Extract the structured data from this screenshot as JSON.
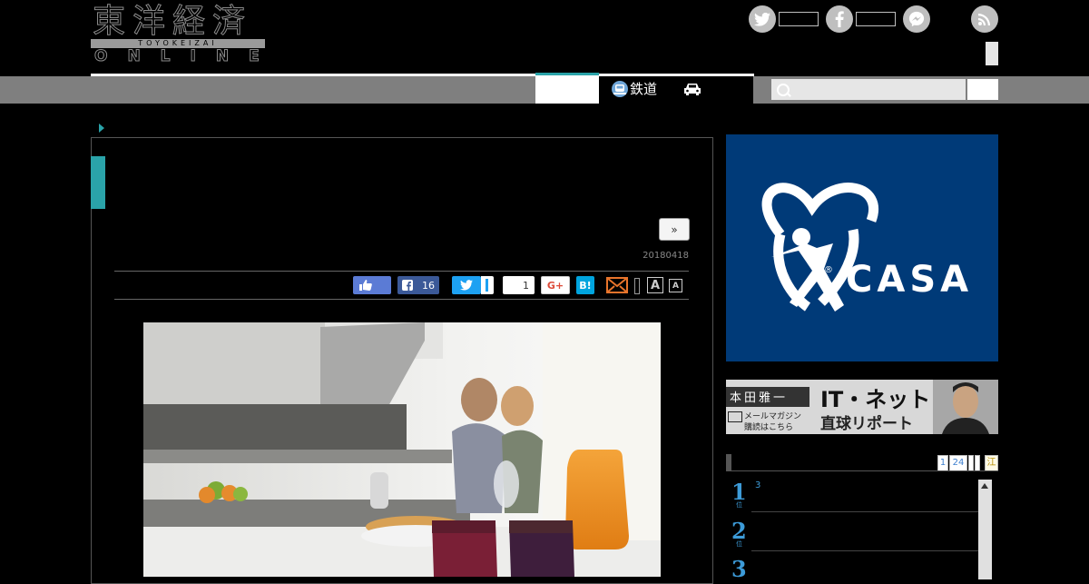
{
  "header": {
    "logo_kanji": "東洋経済",
    "logo_romaji": "TOYOKEIZAI",
    "logo_online": "ONLINE"
  },
  "social": {
    "icons": [
      "twitter-icon",
      "facebook-icon",
      "messenger-icon",
      "rss-icon"
    ]
  },
  "nav": {
    "rail_label": "鉄道",
    "search_placeholder": ""
  },
  "article": {
    "next_label": "»",
    "date": "20180418",
    "share": {
      "facebook_count": "16",
      "pocket_count": "1",
      "gplus_label": "G+",
      "hatena_label": "B!",
      "font_large": "A",
      "font_small": "A"
    }
  },
  "sidebar": {
    "casa_ad": {
      "brand": "CASA",
      "registered": "®"
    },
    "banner": {
      "name": "本田雅一",
      "title": "IT・ネット",
      "subtitle": "直球リポート",
      "newsletter_line1": "メールマガジン",
      "newsletter_line2": "購読はこちら"
    },
    "ranking": {
      "tabs": [
        "1",
        "24"
      ],
      "tab_last": "江",
      "items": [
        {
          "rank": "1",
          "suffix": "位",
          "note": "3"
        },
        {
          "rank": "2",
          "suffix": "位",
          "note": ""
        },
        {
          "rank": "3",
          "suffix": "位",
          "note": ""
        }
      ]
    }
  },
  "colors": {
    "accent_teal": "#2aa3a9",
    "nav_gray": "#7f7f7f",
    "casa_blue": "#003a78",
    "rank_blue": "#3d9bd8"
  }
}
